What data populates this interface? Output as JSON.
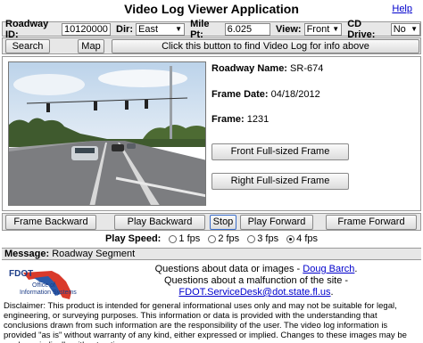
{
  "header": {
    "title": "Video Log Viewer Application",
    "help_link": "Help"
  },
  "query": {
    "roadway_id_label": "Roadway ID:",
    "roadway_id_value": "10120000",
    "dir_label": "Dir:",
    "dir_value": "East",
    "mile_pt_label": "Mile Pt:",
    "mile_pt_value": "6.025",
    "view_label": "View:",
    "view_value": "Front",
    "cd_drive_label": "CD Drive:",
    "cd_drive_value": "No"
  },
  "actions": {
    "search_label": "Search",
    "map_label": "Map",
    "find_label": "Click this button to find Video Log for info above"
  },
  "frame_info": {
    "roadway_name_label": "Roadway Name:",
    "roadway_name_value": "SR-674",
    "frame_date_label": "Frame Date:",
    "frame_date_value": "04/18/2012",
    "frame_label": "Frame:",
    "frame_value": "1231",
    "front_full_label": "Front Full-sized Frame",
    "right_full_label": "Right Full-sized Frame"
  },
  "playback": {
    "frame_backward": "Frame Backward",
    "play_backward": "Play Backward",
    "stop": "Stop",
    "play_forward": "Play Forward",
    "frame_forward": "Frame Forward"
  },
  "speed": {
    "label": "Play Speed:",
    "options": [
      "1 fps",
      "2 fps",
      "3 fps",
      "4 fps"
    ],
    "selected": "4 fps"
  },
  "message": {
    "label": "Message:",
    "value": "Roadway Segment"
  },
  "contact": {
    "line1_prefix": "Questions about data or images - ",
    "line1_link": "Doug Barch",
    "line1_suffix": ".",
    "line2": "Questions about a malfunction of the site -",
    "line3_link": "FDOT.ServiceDesk@dot.state.fl.us",
    "line3_suffix": "."
  },
  "logo": {
    "brand": "FDOT",
    "dept_line1": "Office of",
    "dept_line2": "Information Systems"
  },
  "disclaimer": "Disclaimer: This product is intended for general informational uses only and may not be suitable for legal, engineering, or surveying purposes. This information or data is provided with the understanding that conclusions drawn from such information are the responsibility of the user. The video log information is provided \"as is\" without warranty of any kind, either expressed or implied. Changes to these images may be made periodically without notice."
}
